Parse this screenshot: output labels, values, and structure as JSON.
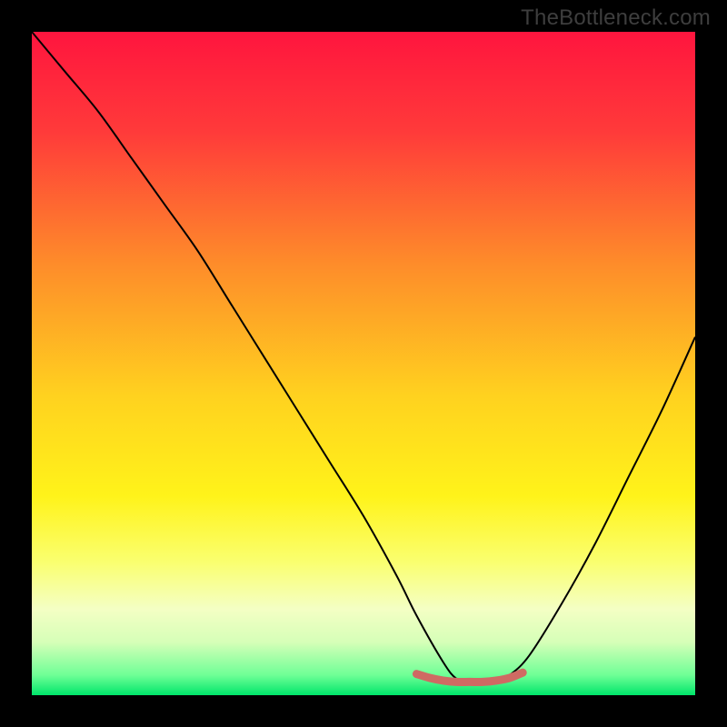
{
  "watermark": "TheBottleneck.com",
  "chart_data": {
    "type": "line",
    "title": "",
    "xlabel": "",
    "ylabel": "",
    "xlim": [
      0,
      100
    ],
    "ylim": [
      0,
      100
    ],
    "grid": false,
    "legend": false,
    "background_gradient_stops": [
      {
        "offset": 0.0,
        "color": "#ff153e"
      },
      {
        "offset": 0.15,
        "color": "#ff3a3a"
      },
      {
        "offset": 0.35,
        "color": "#fe8c2a"
      },
      {
        "offset": 0.55,
        "color": "#ffd21f"
      },
      {
        "offset": 0.7,
        "color": "#fff31a"
      },
      {
        "offset": 0.8,
        "color": "#faff70"
      },
      {
        "offset": 0.87,
        "color": "#f4ffc4"
      },
      {
        "offset": 0.92,
        "color": "#d6ffb8"
      },
      {
        "offset": 0.97,
        "color": "#6eff96"
      },
      {
        "offset": 1.0,
        "color": "#00e56a"
      }
    ],
    "series": [
      {
        "name": "bottleneck-curve",
        "color": "#000000",
        "stroke_width": 2,
        "x": [
          0,
          5,
          10,
          15,
          20,
          25,
          30,
          35,
          40,
          45,
          50,
          55,
          58,
          62,
          64,
          66,
          68,
          70,
          72,
          75,
          80,
          85,
          90,
          95,
          100
        ],
        "y": [
          100,
          94,
          88,
          81,
          74,
          67,
          59,
          51,
          43,
          35,
          27,
          18,
          12,
          5,
          2.5,
          2,
          2,
          2,
          3,
          6,
          14,
          23,
          33,
          43,
          54
        ]
      },
      {
        "name": "highlight-band",
        "color": "#cf6a63",
        "stroke_width": 9,
        "linecap": "round",
        "x": [
          58,
          60,
          62,
          64,
          66,
          68,
          70,
          72,
          74
        ],
        "y": [
          3.2,
          2.6,
          2.2,
          2.0,
          2.0,
          2.0,
          2.2,
          2.6,
          3.4
        ]
      }
    ]
  }
}
